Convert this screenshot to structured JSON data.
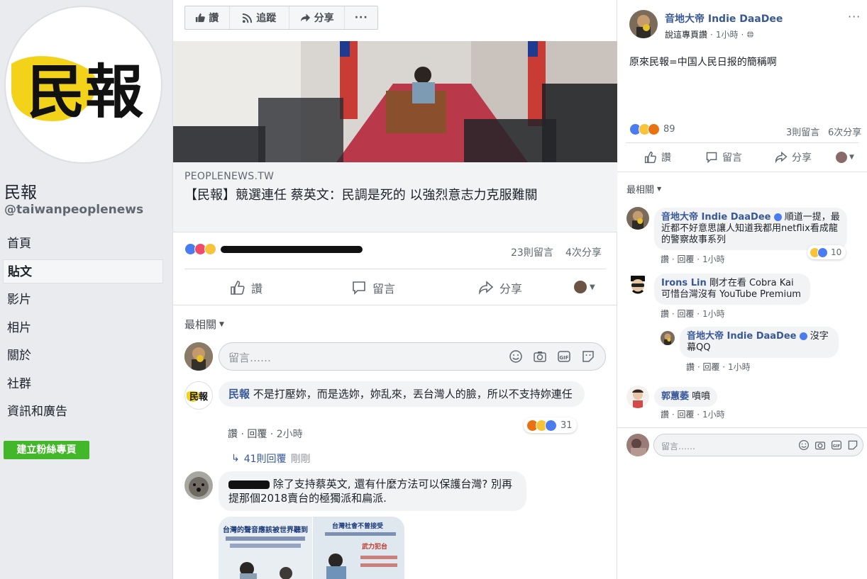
{
  "page": {
    "name": "民報",
    "handle": "@taiwanpeoplenews",
    "logo_text": "民報"
  },
  "nav": {
    "items": [
      "首頁",
      "貼文",
      "影片",
      "相片",
      "關於",
      "社群",
      "資訊和廣告"
    ],
    "active": "貼文",
    "create_button": "建立粉絲專頁"
  },
  "toolbar": {
    "like": "讚",
    "follow": "追蹤",
    "share": "分享",
    "more": "···"
  },
  "article": {
    "domain": "PEOPLENEWS.TW",
    "title": "【民報】競選連任 蔡英文：民調是死的 以強烈意志力克服難關"
  },
  "post_stats": {
    "comments": "23則留言",
    "shares": "4次分享"
  },
  "actions": {
    "like": "讚",
    "comment": "留言",
    "share": "分享"
  },
  "sort_label": "最相關",
  "composer": {
    "placeholder": "留言……"
  },
  "comments": [
    {
      "author": "民報",
      "text": "不是打壓妳，而是选妳，妳乱來，丟台灣人的臉，所以不支持妳連任",
      "like": "讚",
      "reply": "回覆",
      "time": "2小時",
      "reaction_count": "31",
      "replies_label": "41則回覆",
      "replies_time": "剛剛"
    },
    {
      "text": "除了支持蔡英文, 還有什麼方法可以保護台灣? 別再提那個2018賣台的極獨派和扁派."
    }
  ],
  "image_panel": {
    "left_caption_1": "台灣的聲音應該被世界聽到",
    "right_caption_1": "台灣社會不曾接受",
    "right_caption_2": "武力犯台"
  },
  "right_post": {
    "author": "音地大帝 Indie DaaDee",
    "subtitle": "說這專頁讚",
    "time": "1小時",
    "text": "原來民報=中国人民日报的簡稱啊",
    "reaction_count": "89",
    "comments": "3則留言",
    "shares": "6次分享",
    "actions": {
      "like": "讚",
      "comment": "留言",
      "share": "分享"
    },
    "sort_label": "最相關",
    "composer_placeholder": "留言……",
    "comments_list": [
      {
        "author": "音地大帝 Indie DaaDee",
        "text": "順道一提，最近都不好意思讓人知道我都用netflix看成龍的警察故事系列",
        "like": "讚",
        "reply": "回覆",
        "time": "1小時",
        "reaction_count": "10"
      },
      {
        "author": "Irons Lin",
        "text": "剛才在看 Cobra Kai 可惜台灣沒有 YouTube Premium",
        "like": "讚",
        "reply": "回覆",
        "time": "1小時"
      },
      {
        "author": "音地大帝 Indie DaaDee",
        "text": "沒字幕QQ",
        "like": "讚",
        "reply": "回覆",
        "time": "1小時"
      },
      {
        "author": "郭蕙萎",
        "text": "噴噴",
        "like": "讚",
        "reply": "回覆",
        "time": "1小時"
      }
    ]
  },
  "colors": {
    "fb_blue": "#385898",
    "green": "#42b72a",
    "page_bg": "#e9ebee"
  }
}
